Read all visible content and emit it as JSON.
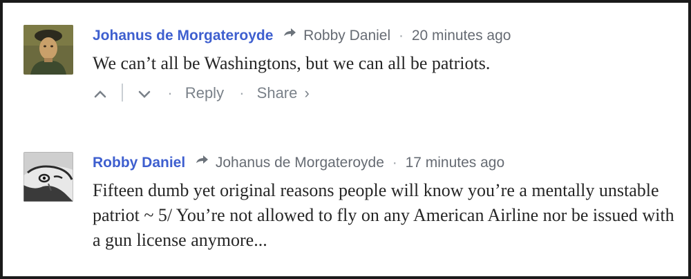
{
  "comments": [
    {
      "author": "Johanus de Morgateroyde",
      "reply_to": "Robby Daniel",
      "separator": "·",
      "timestamp": "20 minutes ago",
      "text": "We can’t all be Washingtons, but we can all be patriots.",
      "actions": {
        "reply_label": "Reply",
        "share_label": "Share",
        "share_chevron": "›",
        "dot": "·"
      },
      "avatar_icon": "painted-portrait-avatar",
      "author_color": "#3e5fcf"
    },
    {
      "author": "Robby Daniel",
      "reply_to": "Johanus de Morgateroyde",
      "separator": "·",
      "timestamp": "17 minutes ago",
      "text": "Fifteen dumb yet original reasons people will know you’re a mentally unstable patriot ~ 5/ You’re not allowed to fly on any American Airline nor be issued with a gun license anymore...",
      "avatar_icon": "sketch-portrait-avatar",
      "author_color": "#3e5fcf"
    }
  ]
}
